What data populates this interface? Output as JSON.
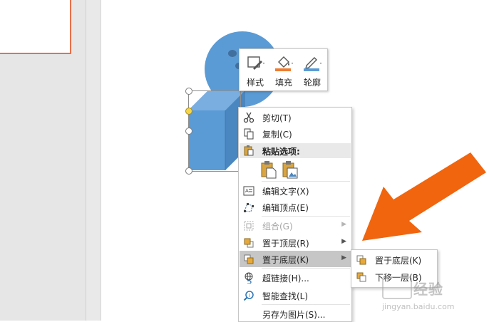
{
  "mini_toolbar": {
    "style_label": "样式",
    "fill_label": "填充",
    "outline_label": "轮廓"
  },
  "context_menu": {
    "items": [
      {
        "label": "剪切(T)",
        "icon": "scissors-icon"
      },
      {
        "label": "复制(C)",
        "icon": "copy-icon"
      },
      {
        "label": "粘贴选项:",
        "icon": "paste-icon"
      },
      {
        "label": "编辑文字(X)",
        "icon": "edit-text-icon"
      },
      {
        "label": "编辑顶点(E)",
        "icon": "edit-points-icon"
      },
      {
        "label": "组合(G)",
        "icon": "group-icon",
        "disabled": true
      },
      {
        "label": "置于顶层(R)",
        "icon": "bring-to-front-icon"
      },
      {
        "label": "置于底层(K)",
        "icon": "send-to-back-icon",
        "highlighted": true
      },
      {
        "label": "超链接(H)...",
        "icon": "hyperlink-icon"
      },
      {
        "label": "智能查找(L)",
        "icon": "smart-lookup-icon"
      },
      {
        "label": "另存为图片(S)..."
      }
    ]
  },
  "submenu": {
    "items": [
      {
        "label": "置于底层(K)",
        "icon": "send-to-back-icon"
      },
      {
        "label": "下移一层(B)",
        "icon": "send-backward-icon"
      }
    ]
  },
  "watermark": {
    "text": "经验",
    "url": "jingyan.baidu.com"
  },
  "colors": {
    "shape_fill": "#5b9bd5",
    "accent_arrow": "#f0650e",
    "fill_icon_bar": "#ed7d31",
    "outline_icon_bar": "#5b9bd5"
  }
}
